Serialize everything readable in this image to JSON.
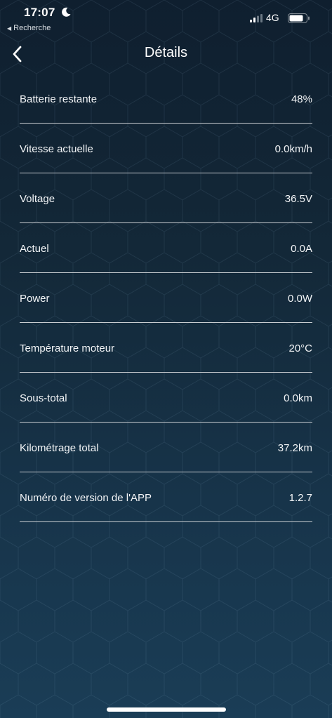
{
  "status_bar": {
    "time": "17:07",
    "back_app": "Recherche",
    "network": "4G",
    "moon_icon": "moon-icon",
    "signal_icon": "signal-icon",
    "battery_icon": "battery-icon"
  },
  "header": {
    "back_icon": "chevron-left-icon",
    "title": "Détails"
  },
  "details": [
    {
      "label": "Batterie restante",
      "value": "48%"
    },
    {
      "label": "Vitesse actuelle",
      "value": "0.0km/h"
    },
    {
      "label": "Voltage",
      "value": "36.5V"
    },
    {
      "label": "Actuel",
      "value": "0.0A"
    },
    {
      "label": "Power",
      "value": "0.0W"
    },
    {
      "label": "Température moteur",
      "value": "20°C"
    },
    {
      "label": "Sous-total",
      "value": "0.0km"
    },
    {
      "label": "Kilométrage total",
      "value": "37.2km"
    },
    {
      "label": "Numéro de version de l'APP",
      "value": "1.2.7"
    }
  ],
  "colors": {
    "background_top": "#0f1f2f",
    "background_bottom": "#1a3d56",
    "divider": "#c8ccd0",
    "text": "#ffffff"
  }
}
